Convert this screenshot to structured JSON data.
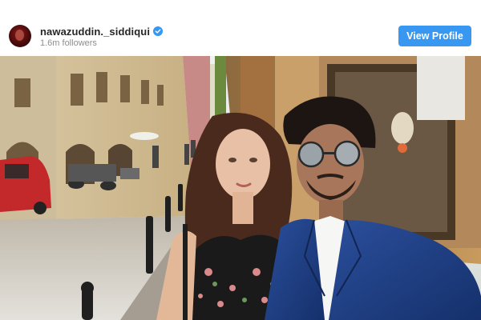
{
  "profile": {
    "username": "nawazuddin._siddiqui",
    "followers": "1.6m followers",
    "verified": true,
    "view_profile_label": "View Profile"
  },
  "colors": {
    "accent": "#3897f0",
    "username": "#262626",
    "muted": "#8e8e8e"
  },
  "icons": {
    "verified": "verified-badge-icon",
    "avatar": "profile-avatar"
  },
  "photo": {
    "type": "selfie photo"
  }
}
